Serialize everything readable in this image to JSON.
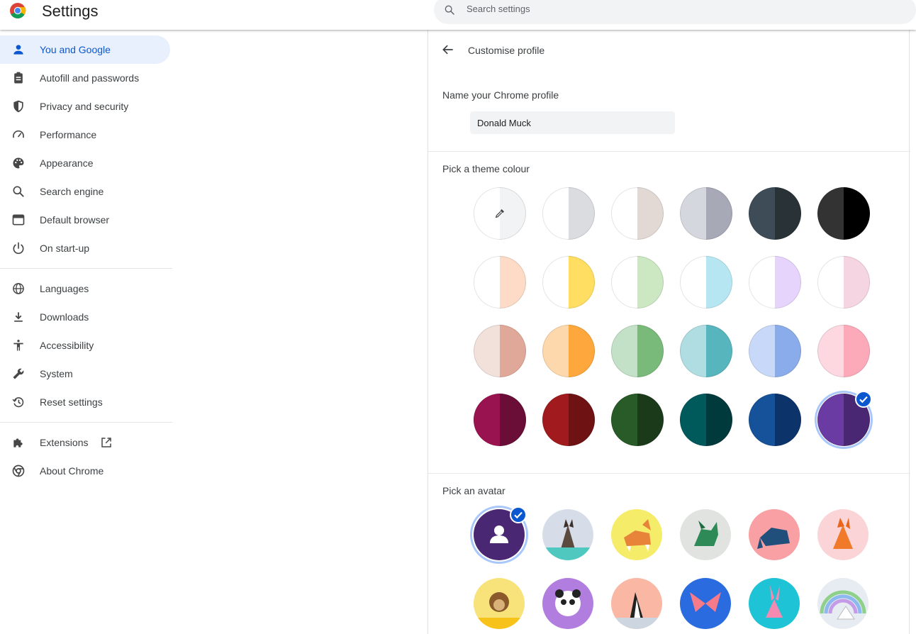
{
  "app": {
    "title": "Settings"
  },
  "search": {
    "placeholder": "Search settings"
  },
  "sidebar": {
    "items": [
      {
        "label": "You and Google",
        "icon": "person-icon",
        "active": true
      },
      {
        "label": "Autofill and passwords",
        "icon": "clipboard-icon"
      },
      {
        "label": "Privacy and security",
        "icon": "shield-icon"
      },
      {
        "label": "Performance",
        "icon": "speedometer-icon"
      },
      {
        "label": "Appearance",
        "icon": "palette-icon"
      },
      {
        "label": "Search engine",
        "icon": "search-icon"
      },
      {
        "label": "Default browser",
        "icon": "browser-window-icon"
      },
      {
        "label": "On start-up",
        "icon": "power-icon"
      },
      {
        "label": "Languages",
        "icon": "globe-icon"
      },
      {
        "label": "Downloads",
        "icon": "download-icon"
      },
      {
        "label": "Accessibility",
        "icon": "accessibility-icon"
      },
      {
        "label": "System",
        "icon": "wrench-icon"
      },
      {
        "label": "Reset settings",
        "icon": "history-icon"
      },
      {
        "label": "Extensions",
        "icon": "puzzle-icon"
      },
      {
        "label": "About Chrome",
        "icon": "chrome-icon"
      }
    ]
  },
  "panel": {
    "title": "Customise profile",
    "name_label": "Name your Chrome profile",
    "name_value": "Donald Muck",
    "theme_label": "Pick a theme colour",
    "avatar_label": "Pick an avatar"
  },
  "themes": [
    {
      "left": "#ffffff",
      "right": "#f1f3f4",
      "picker": true
    },
    {
      "left": "#ffffff",
      "right": "#dadce0"
    },
    {
      "left": "#ffffff",
      "right": "#e2d9d5"
    },
    {
      "left": "#d5d7de",
      "right": "#a7a9b6"
    },
    {
      "left": "#3d4c57",
      "right": "#283237"
    },
    {
      "left": "#333333",
      "right": "#000000"
    },
    {
      "left": "#ffffff",
      "right": "#fddbc7"
    },
    {
      "left": "#ffffff",
      "right": "#ffde62"
    },
    {
      "left": "#ffffff",
      "right": "#cbe8c2"
    },
    {
      "left": "#ffffff",
      "right": "#b6e6f1"
    },
    {
      "left": "#ffffff",
      "right": "#e7d4fd"
    },
    {
      "left": "#ffffff",
      "right": "#f6d5e3"
    },
    {
      "left": "#f2e1db",
      "right": "#e0a898"
    },
    {
      "left": "#fdd8ac",
      "right": "#fda73c"
    },
    {
      "left": "#c3e1c6",
      "right": "#79b979"
    },
    {
      "left": "#afdde1",
      "right": "#57b6bd"
    },
    {
      "left": "#c8d8f8",
      "right": "#8aacea"
    },
    {
      "left": "#fdd8e1",
      "right": "#fcaab9"
    },
    {
      "left": "#9a1351",
      "right": "#6a0d37"
    },
    {
      "left": "#a11b1e",
      "right": "#6e1214"
    },
    {
      "left": "#295b28",
      "right": "#1b3a1a"
    },
    {
      "left": "#005a5c",
      "right": "#003a3c"
    },
    {
      "left": "#16529a",
      "right": "#0c346a"
    },
    {
      "left": "#6a3ba3",
      "right": "#4a2773",
      "selected": true
    }
  ],
  "avatars": [
    {
      "name": "generic-person-avatar",
      "bg": "#4a2773",
      "selected": true
    },
    {
      "name": "origami-cat-avatar",
      "bg": "#d7dde8"
    },
    {
      "name": "origami-corgi-avatar",
      "bg": "#f5ec6a"
    },
    {
      "name": "origami-dragon-avatar",
      "bg": "#e1e3e1"
    },
    {
      "name": "origami-elephant-avatar",
      "bg": "#f8a0a4"
    },
    {
      "name": "origami-fox-avatar",
      "bg": "#fbd4d7"
    },
    {
      "name": "origami-monkey-avatar",
      "bg": "#f7e37a"
    },
    {
      "name": "origami-panda-avatar",
      "bg": "#b17ee0"
    },
    {
      "name": "origami-penguin-avatar",
      "bg": "#f9b7a4"
    },
    {
      "name": "origami-butterfly-avatar",
      "bg": "#2a6be0"
    },
    {
      "name": "origami-rabbit-avatar",
      "bg": "#1ec3d6"
    },
    {
      "name": "origami-unicorn-avatar",
      "bg": "#e6ecf2"
    }
  ]
}
